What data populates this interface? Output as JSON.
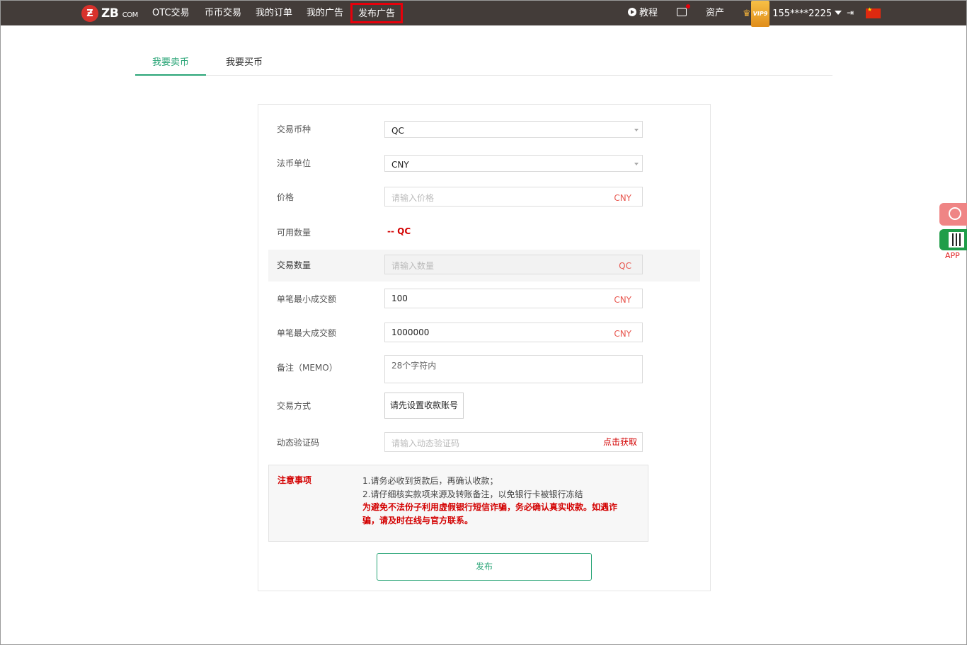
{
  "nav": {
    "logo_text": "ZB",
    "logo_suffix": "COM",
    "items": [
      "OTC交易",
      "币币交易",
      "我的订单",
      "我的广告",
      "发布广告"
    ],
    "tutorial": "教程",
    "assets": "资产",
    "vip": "VIP9",
    "user": "155****2225"
  },
  "tabs": [
    "我要卖币",
    "我要买币"
  ],
  "form": {
    "coin_label": "交易币种",
    "coin_value": "QC",
    "fiat_label": "法币单位",
    "fiat_value": "CNY",
    "price_label": "价格",
    "price_placeholder": "请输入价格",
    "price_unit": "CNY",
    "available_label": "可用数量",
    "available_value": "-- QC",
    "amount_label": "交易数量",
    "amount_placeholder": "请输入数量",
    "amount_unit": "QC",
    "min_label": "单笔最小成交额",
    "min_value": "100",
    "min_unit": "CNY",
    "max_label": "单笔最大成交额",
    "max_value": "1000000",
    "max_unit": "CNY",
    "memo_label": "备注（MEMO）",
    "memo_placeholder": "28个字符内",
    "pay_label": "交易方式",
    "pay_button": "请先设置收款账号",
    "otp_label": "动态验证码",
    "otp_placeholder": "请输入动态验证码",
    "otp_link": "点击获取"
  },
  "notice": {
    "title": "注意事项",
    "line1": "1.请务必收到货款后，再确认收款；",
    "line2": "2.请仔细核实款项来源及转账备注，以免银行卡被银行冻结",
    "warning": "为避免不法份子利用虚假银行短信诈骗，务必确认真实收款。如遇诈骗，请及时在线与官方联系。"
  },
  "submit": "发布",
  "side": {
    "app": "APP"
  },
  "colors": {
    "nav_bg": "#433c39",
    "accent": "#2aa577",
    "alert": "#d30000",
    "unit": "#e8574f"
  }
}
